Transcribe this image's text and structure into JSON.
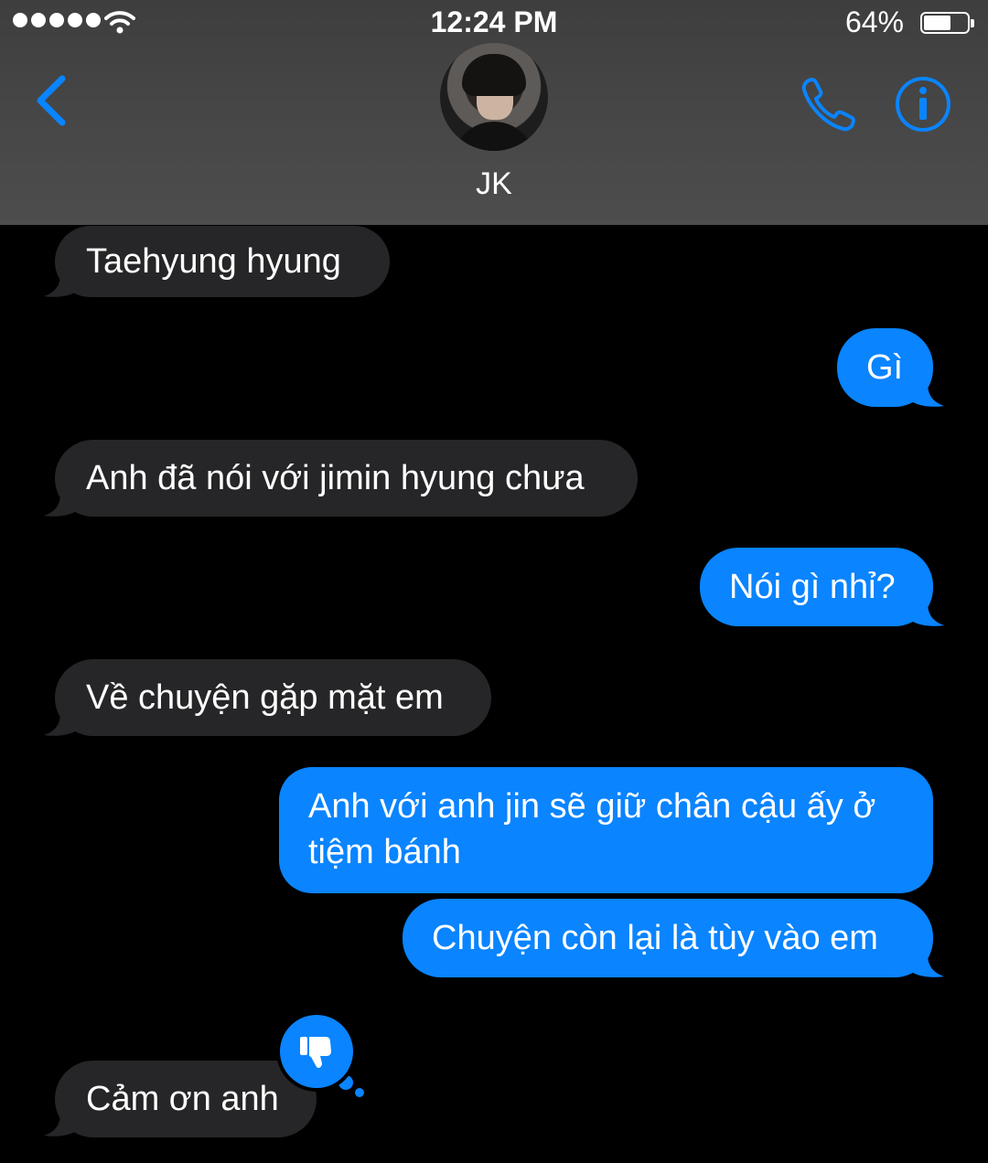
{
  "status_bar": {
    "time": "12:24 PM",
    "battery_percent": "64%",
    "battery_level": 0.64,
    "signal_icon": "signal-dots-icon",
    "wifi_icon": "wifi-icon"
  },
  "header": {
    "back_icon": "chevron-left-icon",
    "contact_name": "JK",
    "call_icon": "phone-icon",
    "info_icon": "info-icon",
    "accent_color": "#0a84ff"
  },
  "messages": [
    {
      "direction": "incoming",
      "text": "Taehyung hyung"
    },
    {
      "direction": "outgoing",
      "text": "Gì"
    },
    {
      "direction": "incoming",
      "text": "Anh đã nói với jimin hyung chưa"
    },
    {
      "direction": "outgoing",
      "text": "Nói gì nhỉ?"
    },
    {
      "direction": "incoming",
      "text": "Về chuyện gặp mặt em"
    },
    {
      "direction": "outgoing",
      "text": "Anh với anh jin sẽ giữ chân cậu ấy ở tiệm bánh"
    },
    {
      "direction": "outgoing",
      "text": "Chuyện còn lại là tùy vào em"
    },
    {
      "direction": "incoming",
      "text": "Cảm ơn anh",
      "reaction": "thumbs-down-icon"
    }
  ],
  "colors": {
    "incoming_bubble": "#262628",
    "outgoing_bubble": "#0a84ff",
    "background": "#000000"
  }
}
